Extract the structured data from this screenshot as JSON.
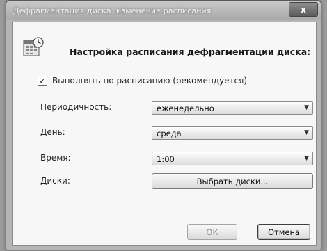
{
  "window": {
    "title": "Дефрагментация диска: изменение расписания",
    "close_glyph": "x"
  },
  "header": {
    "text": "Настройка расписания дефрагментации диска:",
    "icon": "calendar-clock-icon"
  },
  "schedule_checkbox": {
    "label": "Выполнять по расписанию (рекомендуется)",
    "checked": true,
    "mark": "✓"
  },
  "frequency": {
    "label": "Периодичность:",
    "value": "еженедельно"
  },
  "day": {
    "label": "День:",
    "value": "среда"
  },
  "time": {
    "label": "Время:",
    "value": "1:00"
  },
  "disks": {
    "label": "Диски:",
    "button_label": "Выбрать диски..."
  },
  "buttons": {
    "ok": "ОК",
    "cancel": "Отмена"
  },
  "dropdown_glyph": "▼"
}
